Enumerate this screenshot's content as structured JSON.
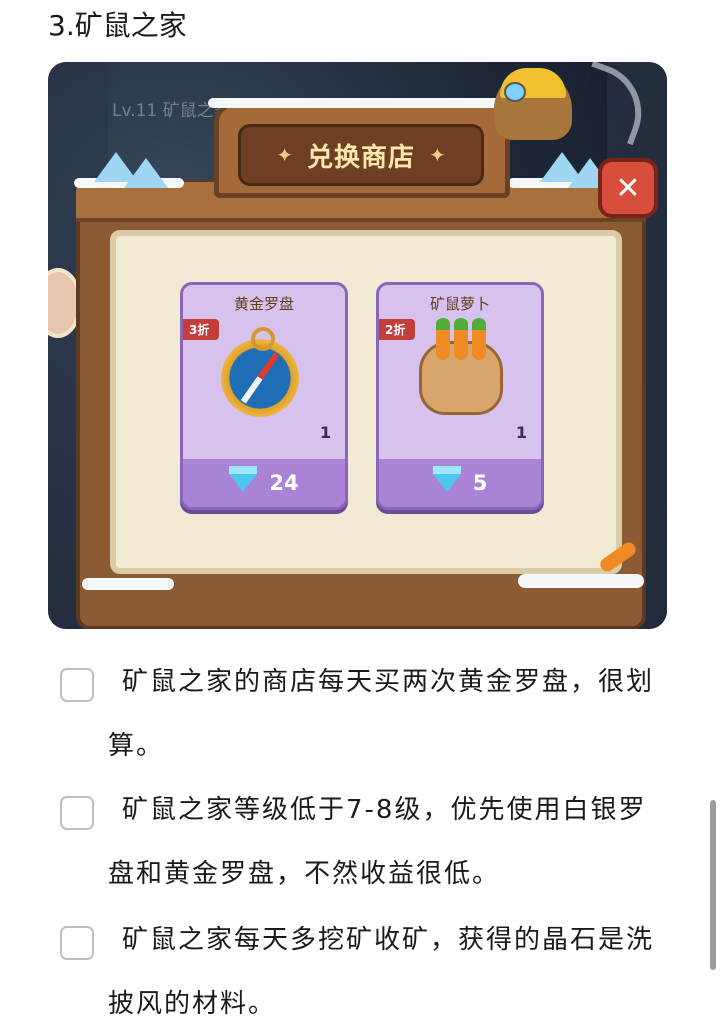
{
  "section_title": "3.矿鼠之家",
  "screenshot": {
    "level_label": "Lv.11 矿鼠之家",
    "shop_title": "兑换商店",
    "title_spark": "✦",
    "close_icon": "✕",
    "items": [
      {
        "name": "黄金罗盘",
        "discount": "3折",
        "quantity": "1",
        "price": "24",
        "currency_icon": "diamond-icon"
      },
      {
        "name": "矿鼠萝卜",
        "discount": "2折",
        "quantity": "1",
        "price": "5",
        "currency_icon": "diamond-icon"
      }
    ],
    "colors": {
      "frame": "#8c5a33",
      "card": "#d7c2ee",
      "price_bar": "#a983d6",
      "close": "#d84e3c",
      "discount_badge": "#c23e3a"
    }
  },
  "checklist": [
    {
      "text": "矿鼠之家的商店每天买两次黄金罗盘，很划算。",
      "checked": false
    },
    {
      "text": "矿鼠之家等级低于7-8级，优先使用白银罗盘和黄金罗盘，不然收益很低。",
      "checked": false
    },
    {
      "text": "矿鼠之家每天多挖矿收矿，获得的晶石是洗披风的材料。",
      "checked": false
    }
  ]
}
